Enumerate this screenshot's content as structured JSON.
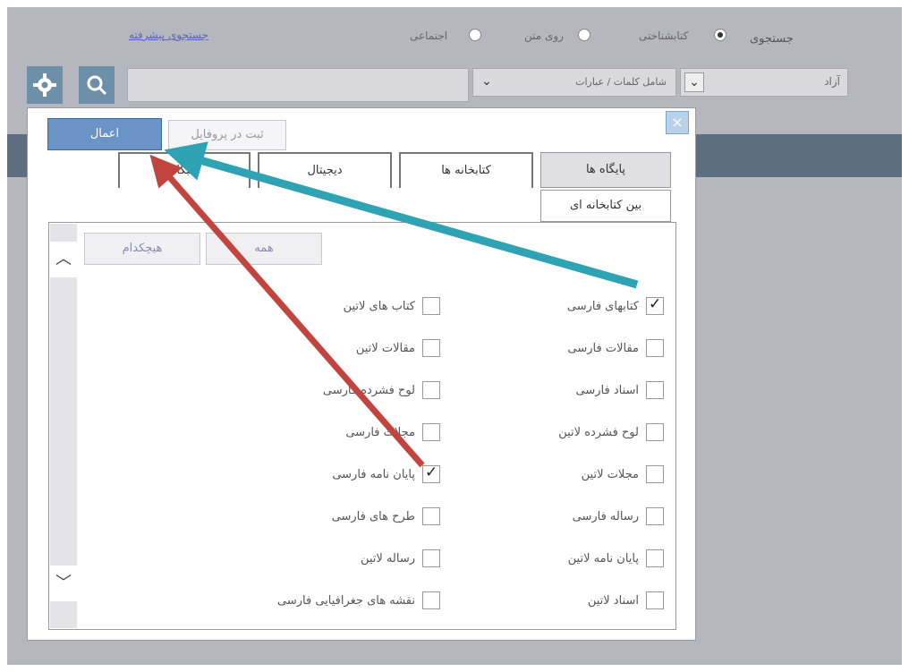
{
  "header": {
    "search_label": "جستجوی",
    "advanced_link": "جستجوی پیشرفته",
    "radios": [
      {
        "label": "کتابشناختی",
        "selected": true
      },
      {
        "label": "روی متن",
        "selected": false
      },
      {
        "label": "اجتماعی",
        "selected": false
      }
    ]
  },
  "search_bar": {
    "field_dropdown": "آزاد",
    "match_dropdown": "شامل کلمات / عبارات",
    "query_value": "",
    "search_icon": "search-icon",
    "settings_icon": "gear-icon"
  },
  "dialog": {
    "close_label": "×",
    "apply_label": "اعمال",
    "save_label": "ثبت در پروفایل",
    "tabs": [
      "پایگاه ها",
      "کتابخانه ها",
      "دیجیتال",
      "نخبگان"
    ],
    "tab_sub": "بین کتابخانه ای",
    "select_all_label": "همه",
    "select_none_label": "هیچکدام",
    "right_column": [
      {
        "label": "کتابهای فارسی",
        "checked": true
      },
      {
        "label": "مقالات فارسی",
        "checked": false
      },
      {
        "label": "اسناد فارسی",
        "checked": false
      },
      {
        "label": "لوح فشرده لاتین",
        "checked": false
      },
      {
        "label": "مجلات لاتین",
        "checked": false
      },
      {
        "label": "رساله فارسی",
        "checked": false
      },
      {
        "label": "پایان نامه لاتین",
        "checked": false
      },
      {
        "label": "اسناد لاتین",
        "checked": false
      }
    ],
    "left_column": [
      {
        "label": "کتاب های لاتین",
        "checked": false
      },
      {
        "label": "مقالات لاتین",
        "checked": false
      },
      {
        "label": "لوح فشرده فارسی",
        "checked": false
      },
      {
        "label": "مجلات فارسی",
        "checked": false
      },
      {
        "label": "پایان نامه فارسی",
        "checked": true
      },
      {
        "label": "طرح های فارسی",
        "checked": false
      },
      {
        "label": "رساله لاتین",
        "checked": false
      },
      {
        "label": "نقشه های جغرافیایی فارسی",
        "checked": false
      }
    ]
  },
  "colors": {
    "accent_blue": "#6b94c6",
    "arrow_teal": "#2fa3b3",
    "arrow_red": "#c2443e"
  }
}
